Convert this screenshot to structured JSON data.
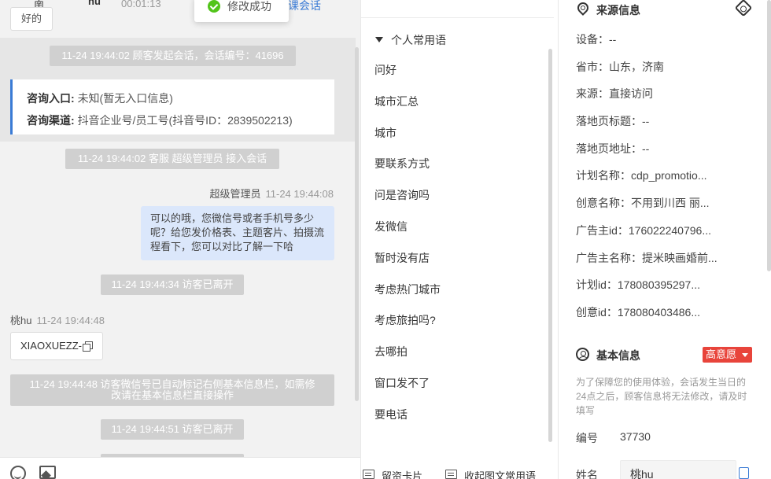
{
  "chat": {
    "top_name_left": "南",
    "top_name_mid": "hu",
    "top_time": "00:01:13",
    "top_link": "课会话",
    "good_chip": "好的",
    "session_start": "11-24 19:44:02 顾客发起会话，会话编号：41696",
    "entry_label": "咨询入口:",
    "entry_value": "未知(暂无入口信息)",
    "channel_label": "咨询渠道:",
    "channel_value": "抖音企业号/员工号(抖音号ID：2839502213)",
    "agent_joined": "11-24 19:44:02 客服 超级管理员 接入会话",
    "agent_name": "超级管理员",
    "agent_time": "11-24 19:44:08",
    "agent_message": "可以的哦，您微信号或者手机号多少呢？给您发价格表、主题客片、拍摄流程看下，您可以对比了解一下哈",
    "visitor_left_1": "11-24 19:44:34 访客已离开",
    "visitor_name": "桃hu",
    "visitor_time": "11-24 19:44:48",
    "visitor_message": "XIAOXUEZZ-",
    "wechat_notice_line1": "11-24 19:44:48 访客微信号已自动标记右侧基本信息栏，如需修",
    "wechat_notice_line2": "改请在基本信息栏直接操作",
    "visitor_left_2": "11-24 19:44:51 访客已离开"
  },
  "toast": {
    "text": "修改成功",
    "color": "#52c41a"
  },
  "phrases": {
    "group_label": "个人常用语",
    "items": [
      "问好",
      "城市汇总",
      "城市",
      "要联系方式",
      "问是咨询吗",
      "发微信",
      "暂时没有店",
      "考虑热门城市",
      "考虑旅拍吗?",
      "去哪拍",
      "窗口发不了",
      "要电话"
    ],
    "footer_card": "留资卡片",
    "footer_collapse": "收起图文常用语"
  },
  "source": {
    "title": "来源信息",
    "rows": [
      "设备：--",
      "省市：山东，济南",
      "来源：直接访问",
      "落地页标题：--",
      "落地页地址：--",
      "计划名称：cdp_promotio...",
      "创意名称：不用到川西 丽...",
      "广告主id：176022240796...",
      "广告主名称：提米映画婚前...",
      "计划id：178080395297...",
      "创意id：178080403486..."
    ]
  },
  "basic": {
    "title": "基本信息",
    "intent_badge": "高意愿",
    "intent_color": "#e8443b",
    "note": "为了保障您的使用体验，会话发生当日的24点之后，顾客信息将无法修改，请及时填写",
    "id_label": "编号",
    "id_value": "37730",
    "name_label": "姓名",
    "name_value": "桃hu"
  },
  "colors": {
    "accent": "#3a7bd5",
    "agent_bubble": "#dbe7fb",
    "system_pill": "#d0d0d0"
  }
}
